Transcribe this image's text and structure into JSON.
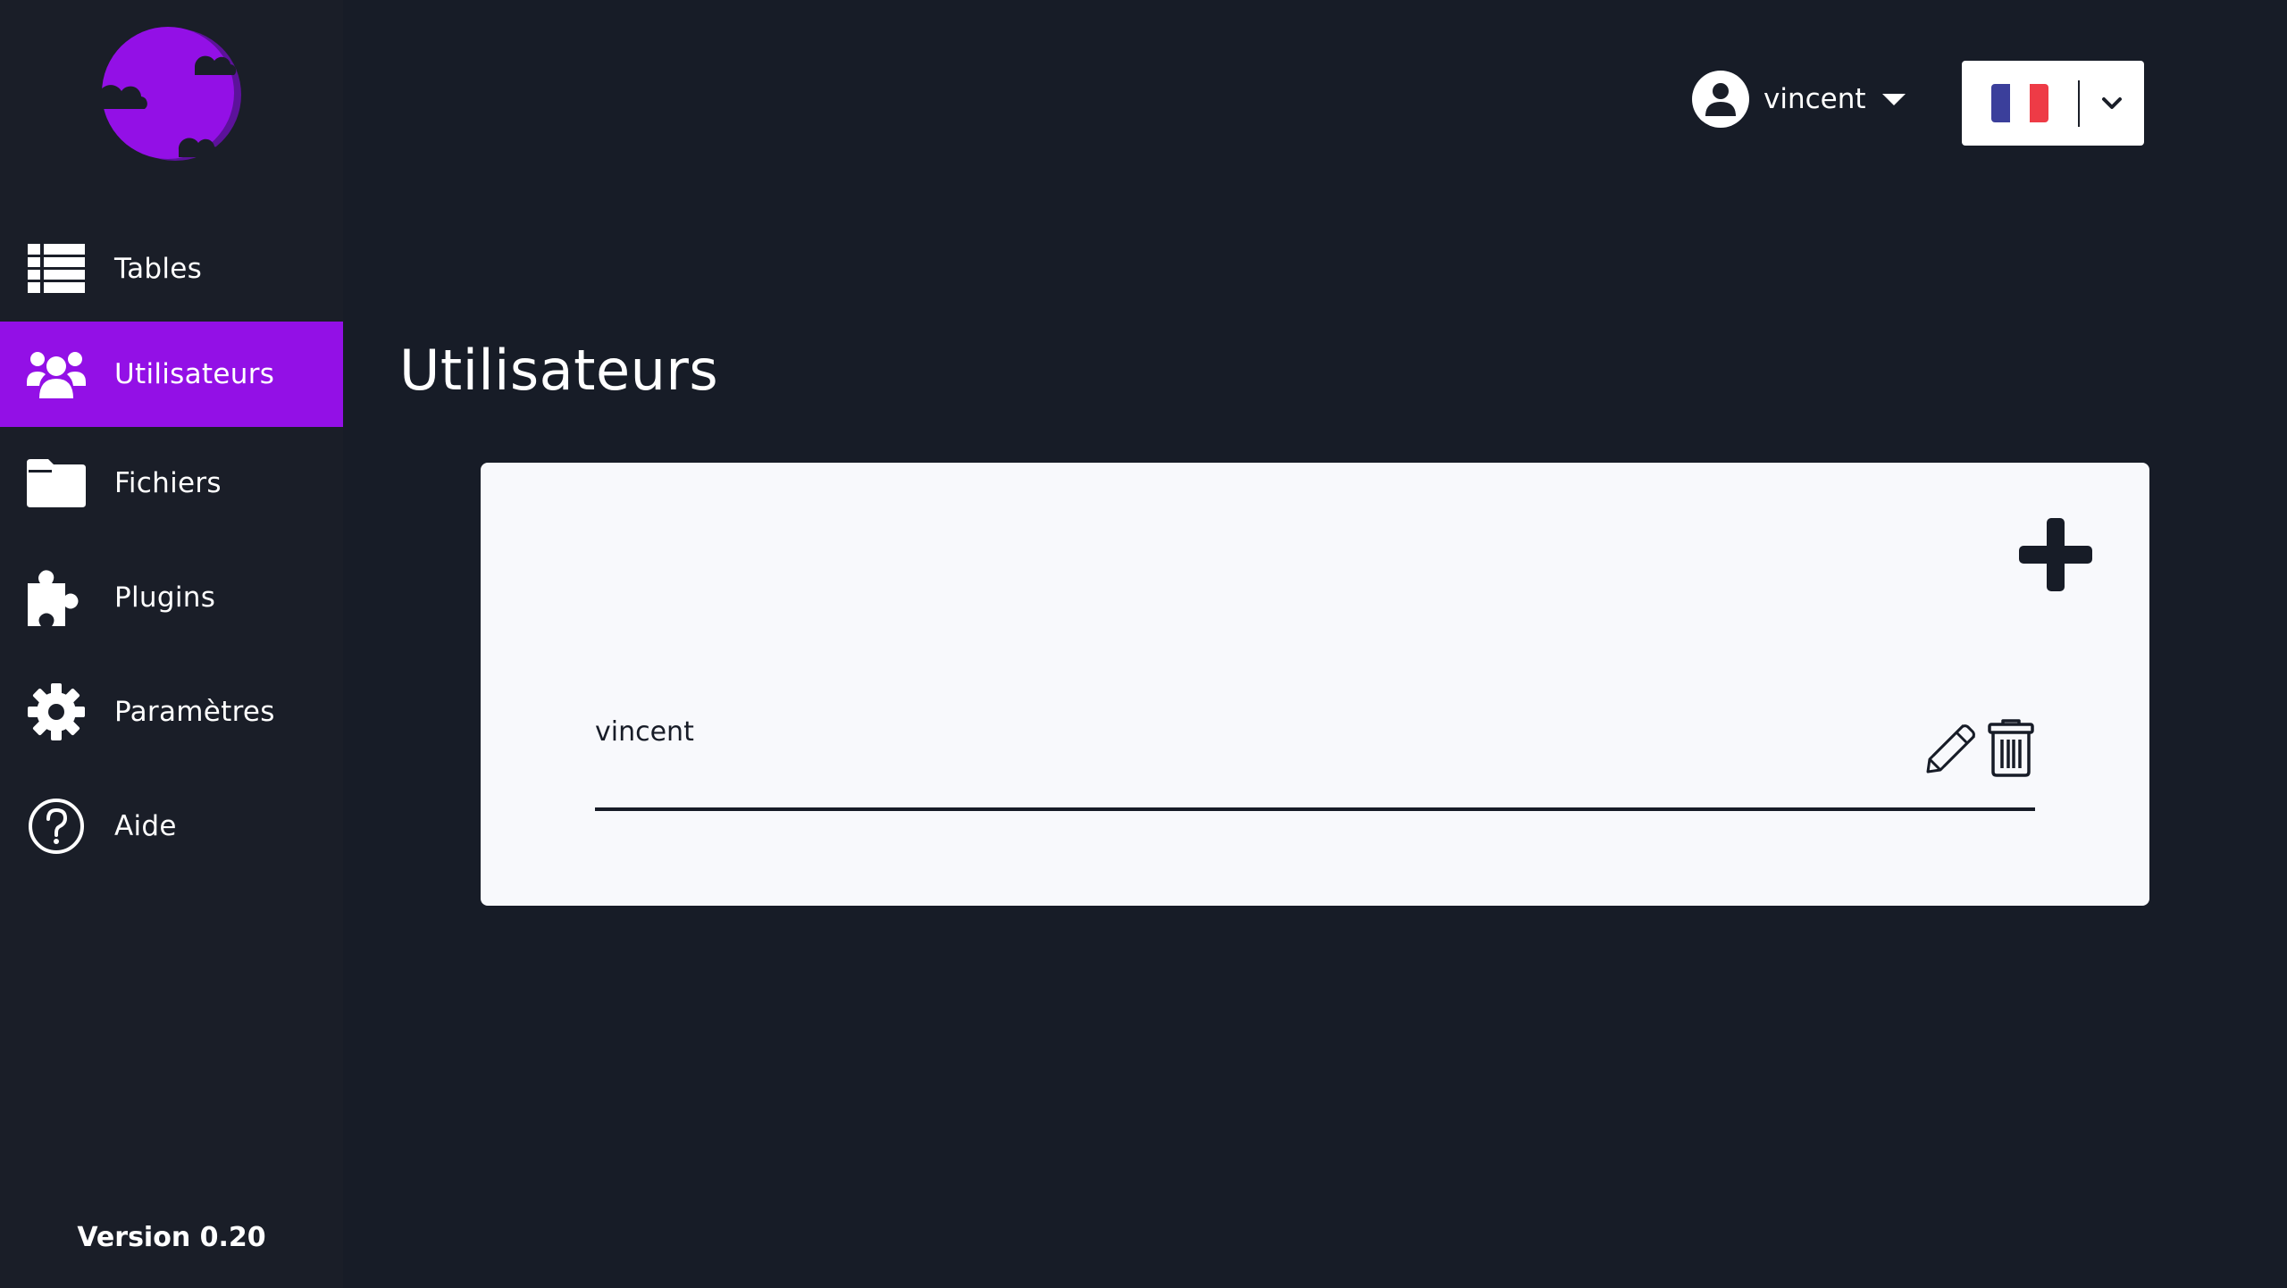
{
  "sidebar": {
    "items": [
      {
        "label": "Tables",
        "icon": "table-list-icon",
        "active": false
      },
      {
        "label": "Utilisateurs",
        "icon": "users-icon",
        "active": true
      },
      {
        "label": "Fichiers",
        "icon": "folder-icon",
        "active": false
      },
      {
        "label": "Plugins",
        "icon": "puzzle-icon",
        "active": false
      },
      {
        "label": "Paramètres",
        "icon": "gear-icon",
        "active": false
      },
      {
        "label": "Aide",
        "icon": "help-circle-icon",
        "active": false
      }
    ],
    "version": "Version 0.20"
  },
  "header": {
    "user_name": "vincent",
    "language": "fr"
  },
  "main": {
    "title": "Utilisateurs",
    "users": [
      {
        "name": "vincent"
      }
    ]
  },
  "colors": {
    "background": "#171c27",
    "sidebar": "#1a1e28",
    "accent": "#9310e6",
    "card": "#f8f9fc"
  }
}
